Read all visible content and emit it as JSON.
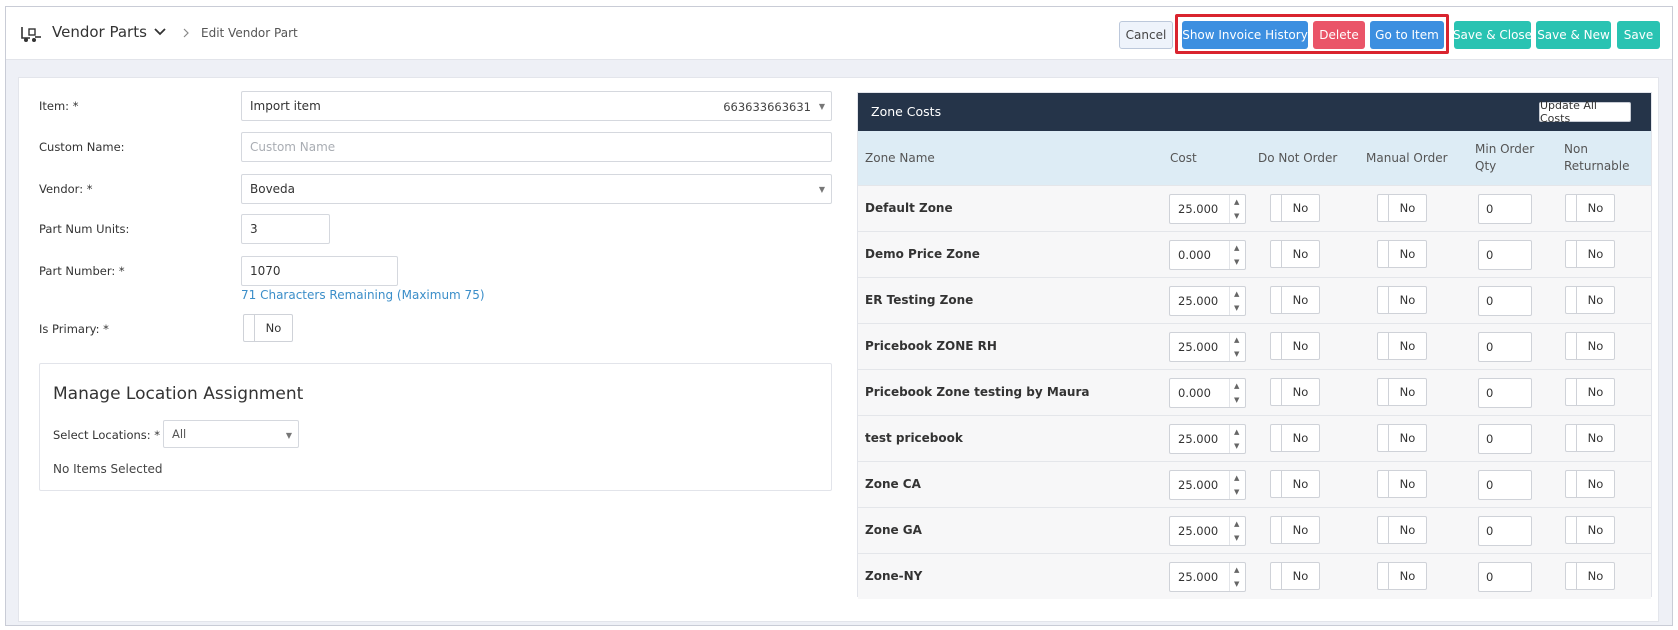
{
  "header": {
    "title": "Vendor Parts",
    "breadcrumb": "Edit Vendor Part",
    "buttons": {
      "cancel": "Cancel",
      "invoice": "Show Invoice History",
      "delete": "Delete",
      "goto": "Go to Item",
      "save_close": "Save & Close",
      "save_new": "Save & New",
      "save": "Save"
    }
  },
  "form": {
    "item_label": "Item: *",
    "item_value": "Import item",
    "item_code": "663633663631",
    "custom_name_label": "Custom Name:",
    "custom_name_placeholder": "Custom Name",
    "vendor_label": "Vendor: *",
    "vendor_value": "Boveda",
    "units_label": "Part Num Units:",
    "units_value": "3",
    "part_number_label": "Part Number: *",
    "part_number_value": "1070",
    "part_number_helper": "71 Characters Remaining (Maximum 75)",
    "is_primary_label": "Is Primary: *",
    "is_primary_value": "No"
  },
  "locations": {
    "title": "Manage Location Assignment",
    "select_label": "Select Locations: *",
    "select_value": "All",
    "empty_text": "No Items Selected"
  },
  "zone_costs": {
    "title": "Zone Costs",
    "update_button": "Update All Costs",
    "columns": {
      "zone_name": "Zone Name",
      "cost": "Cost",
      "do_not_order": "Do Not Order",
      "manual_order": "Manual Order",
      "min_order_qty_1": "Min Order",
      "min_order_qty_2": "Qty",
      "non_returnable_1": "Non",
      "non_returnable_2": "Returnable"
    },
    "rows": [
      {
        "name": "Default Zone",
        "cost": "25.000",
        "do_not_order": "No",
        "manual_order": "No",
        "min_qty": "0",
        "non_returnable": "No"
      },
      {
        "name": "Demo Price Zone",
        "cost": "0.000",
        "do_not_order": "No",
        "manual_order": "No",
        "min_qty": "0",
        "non_returnable": "No"
      },
      {
        "name": "ER Testing Zone",
        "cost": "25.000",
        "do_not_order": "No",
        "manual_order": "No",
        "min_qty": "0",
        "non_returnable": "No"
      },
      {
        "name": "Pricebook ZONE RH",
        "cost": "25.000",
        "do_not_order": "No",
        "manual_order": "No",
        "min_qty": "0",
        "non_returnable": "No"
      },
      {
        "name": "Pricebook Zone testing by Maura",
        "cost": "0.000",
        "do_not_order": "No",
        "manual_order": "No",
        "min_qty": "0",
        "non_returnable": "No"
      },
      {
        "name": "test pricebook",
        "cost": "25.000",
        "do_not_order": "No",
        "manual_order": "No",
        "min_qty": "0",
        "non_returnable": "No"
      },
      {
        "name": "Zone CA",
        "cost": "25.000",
        "do_not_order": "No",
        "manual_order": "No",
        "min_qty": "0",
        "non_returnable": "No"
      },
      {
        "name": "Zone GA",
        "cost": "25.000",
        "do_not_order": "No",
        "manual_order": "No",
        "min_qty": "0",
        "non_returnable": "No"
      },
      {
        "name": "Zone-NY",
        "cost": "25.000",
        "do_not_order": "No",
        "manual_order": "No",
        "min_qty": "0",
        "non_returnable": "No"
      }
    ]
  },
  "icons": {
    "app": "vendor-parts-icon",
    "dropdown": "chevron-down-icon",
    "separator": "chevron-right-icon"
  },
  "colors": {
    "primary": "#3c8fe0",
    "danger": "#ea5468",
    "success": "#29c3b2",
    "zone_header": "#253449",
    "table_header": "#ddecf5",
    "highlight": "#d9242f"
  }
}
